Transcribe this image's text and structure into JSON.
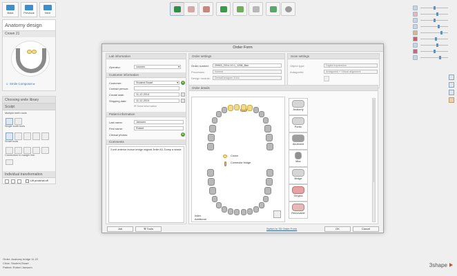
{
  "nav": {
    "back": "Back",
    "prev": "Previous",
    "next": "Next"
  },
  "left": {
    "title": "Anatomy design",
    "subtitle": "Crown 21",
    "smile_label": "Smile Composer",
    "choose_lib": "Choosing smile library",
    "sculpt": "Sculpt",
    "multiple_tools": "Multiple teeth tools",
    "single_tools": "Single tooth tools",
    "smart_tools": "Smart tools",
    "connect_line": "Connection to margin line",
    "indiv_trans": "Individual transformation",
    "lift_label": "Lift proximal off"
  },
  "status": {
    "order": "Order: Anatomy bridge 11-22",
    "clinic": "Clinic: Student,Stuart",
    "patient": "Patient: Robert Janssen"
  },
  "brand": "3shape",
  "dialog": {
    "title": "Order Form",
    "lab_info": "Lab information",
    "operator_label": "Operator:",
    "operator_val": "cosmex",
    "customer_info": "Customer information",
    "customer_label": "Customer:",
    "customer_val": "Student,Stuart",
    "contact_label": "Contact person:",
    "create_label": "Create date:",
    "create_val": "11-12-2014",
    "ship_label": "Shipping date:",
    "ship_val": "11-12-2014",
    "send_label": "Send information",
    "patient_info": "Patient information",
    "last_label": "Last name:",
    "last_val": "Janssen",
    "first_label": "First name:",
    "first_val": "Robert",
    "photos_label": "Clinical photos:",
    "comments": "Comments",
    "comment_text": "3 unit anterior incisor bridge original 3mile A3. Dump a shade",
    "btn_job": "Job",
    "btn_tools": "Tools",
    "order_settings": "Order settings",
    "ordernum_label": "Order number:",
    "ordernum_val": "29963_2014-10-1_1258_Bao",
    "process_label": "Processes:",
    "process_val": "Normal",
    "design_label": "Design module:",
    "design_val": "DentalDesigner 2014",
    "scan_settings": "Scan settings",
    "object_label": "Object type:",
    "object_val": "Digital impression",
    "antag_label": "Antagonist:",
    "antag_val": "Antagonist + Virtual alignment",
    "order_details": "Order details",
    "legend_crown": "Crown",
    "legend_connector": "Connector bridge",
    "bottom_note1": "Index",
    "bottom_note2": "Additional",
    "switch_link": "Switch to 3D Order Form",
    "ok": "OK",
    "cancel": "Cancel",
    "types": [
      "Anatomy",
      "Pontic",
      "Abutment",
      "Misc",
      "Bridge",
      "Gingiva",
      "Removable"
    ]
  }
}
